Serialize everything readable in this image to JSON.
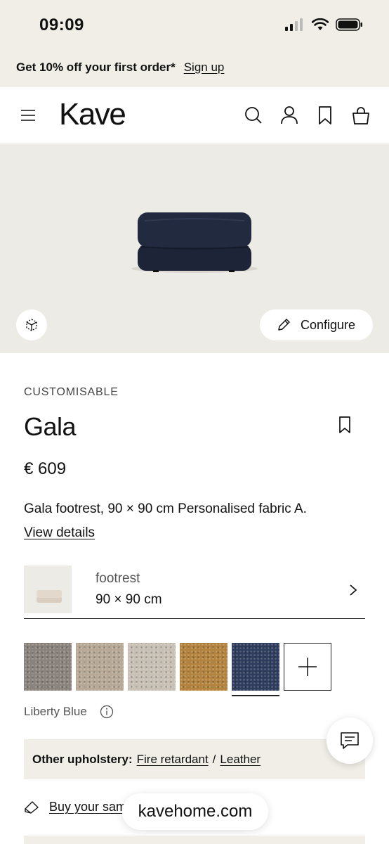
{
  "status_bar": {
    "time": "09:09"
  },
  "promo": {
    "text": "Get 10% off your first order*",
    "link": "Sign up"
  },
  "header": {
    "logo": "Kave"
  },
  "hero": {
    "configure_label": "Configure"
  },
  "product": {
    "eyebrow": "CUSTOMISABLE",
    "title": "Gala",
    "price": "€ 609",
    "description": "Gala footrest, 90 × 90 cm Personalised fabric A.",
    "details_link": "View details"
  },
  "variant": {
    "name": "footrest",
    "size": "90 × 90 cm"
  },
  "swatches": {
    "colors": [
      "#8a837d",
      "#b7a895",
      "#c8c0b4",
      "#b3823d",
      "#2e3d5e"
    ],
    "selected_index": 4,
    "selected_name": "Liberty Blue"
  },
  "upholstery": {
    "label": "Other upholstery:",
    "options": [
      "Fire retardant",
      "Leather"
    ],
    "separator": "/"
  },
  "samples": {
    "link": "Buy your sam"
  },
  "browser": {
    "url": "kavehome.com"
  }
}
